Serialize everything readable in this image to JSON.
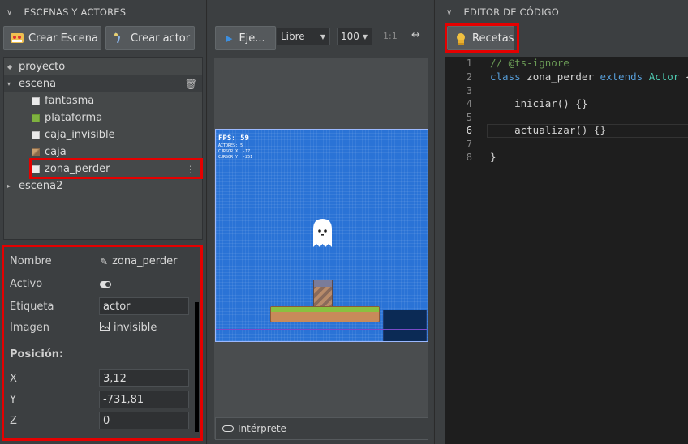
{
  "left_panel": {
    "header": "ESCENAS Y ACTORES",
    "btn_create_scene": "Crear Escena",
    "btn_create_actor": "Crear actor",
    "tree": [
      {
        "label": "proyecto"
      },
      {
        "label": "escena"
      },
      {
        "label": "fantasma"
      },
      {
        "label": "plataforma"
      },
      {
        "label": "caja_invisible"
      },
      {
        "label": "caja"
      },
      {
        "label": "zona_perder"
      },
      {
        "label": "escena2"
      }
    ]
  },
  "properties": {
    "nombre_label": "Nombre",
    "nombre_value": "zona_perder",
    "activo_label": "Activo",
    "etiqueta_label": "Etiqueta",
    "etiqueta_value": "actor",
    "imagen_label": "Imagen",
    "imagen_value": "invisible",
    "posicion_heading": "Posición:",
    "x_label": "X",
    "x_value": "3,12",
    "y_label": "Y",
    "y_value": "-731,81",
    "z_label": "Z",
    "z_value": "0"
  },
  "toolbar": {
    "run_label": "Eje...",
    "mode_select": "Libre",
    "zoom_select": "100",
    "ratio_label": "1:1",
    "expand_icon": "↔"
  },
  "game": {
    "fps": "FPS: 59",
    "debug_lines": [
      "ACTORES: 5",
      "CURSOR X: -17",
      "CURSOR Y: -251"
    ]
  },
  "interpreter_label": "Intérprete",
  "right_panel": {
    "header": "EDITOR DE CÓDIGO",
    "recipes_label": "Recetas",
    "line_numbers": [
      "1",
      "2",
      "3",
      "4",
      "5",
      "6",
      "7",
      "8"
    ],
    "code": {
      "l1": "// @ts-ignore",
      "l2_class": "class",
      "l2_name": " zona_perder ",
      "l2_extends": "extends",
      "l2_type": " Actor",
      "l2_brace": " {",
      "l4": "    iniciar() {}",
      "l6": "    actualizar() {}",
      "l8": "}"
    }
  },
  "colors": {
    "highlight": "#e50000",
    "canvas_bg": "#2a73d6",
    "accent_play": "#3d8fe0"
  }
}
